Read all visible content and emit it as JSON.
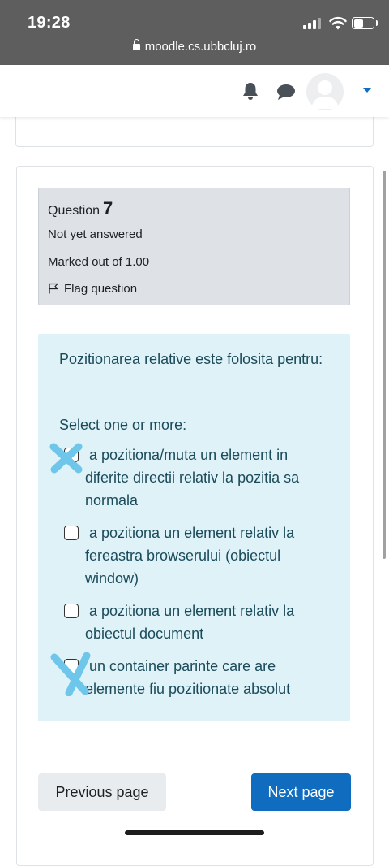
{
  "status_bar": {
    "time": "19:28",
    "url": "moodle.cs.ubbcluj.ro"
  },
  "navbar": {
    "icons": [
      "bell-icon",
      "chat-icon",
      "user-avatar",
      "chevron-down-icon"
    ],
    "accent_color": "#0f6cbf"
  },
  "question_info": {
    "question_label": "Question",
    "question_number": "7",
    "state": "Not yet answered",
    "grade": "Marked out of 1.00",
    "flag_label": "Flag question"
  },
  "question": {
    "text": "Pozitionarea relative este folosita pentru:",
    "prompt": "Select one or more:",
    "options": [
      {
        "label": "a pozitiona/muta un element in diferite directii relativ la pozitia sa normala",
        "checked": false
      },
      {
        "label": "a pozitiona un element relativ la fereastra browserului (obiectul window)",
        "checked": false
      },
      {
        "label": "a pozitiona un element relativ la obiectul document",
        "checked": false
      },
      {
        "label": "un container parinte care are elemente fiu pozitionate absolut",
        "checked": false
      }
    ]
  },
  "navigation": {
    "previous_label": "Previous page",
    "next_label": "Next page"
  },
  "colors": {
    "info_bg": "#dee2e6",
    "formulation_bg": "#def2f8",
    "annotation_mark": "#6ec6ea"
  }
}
